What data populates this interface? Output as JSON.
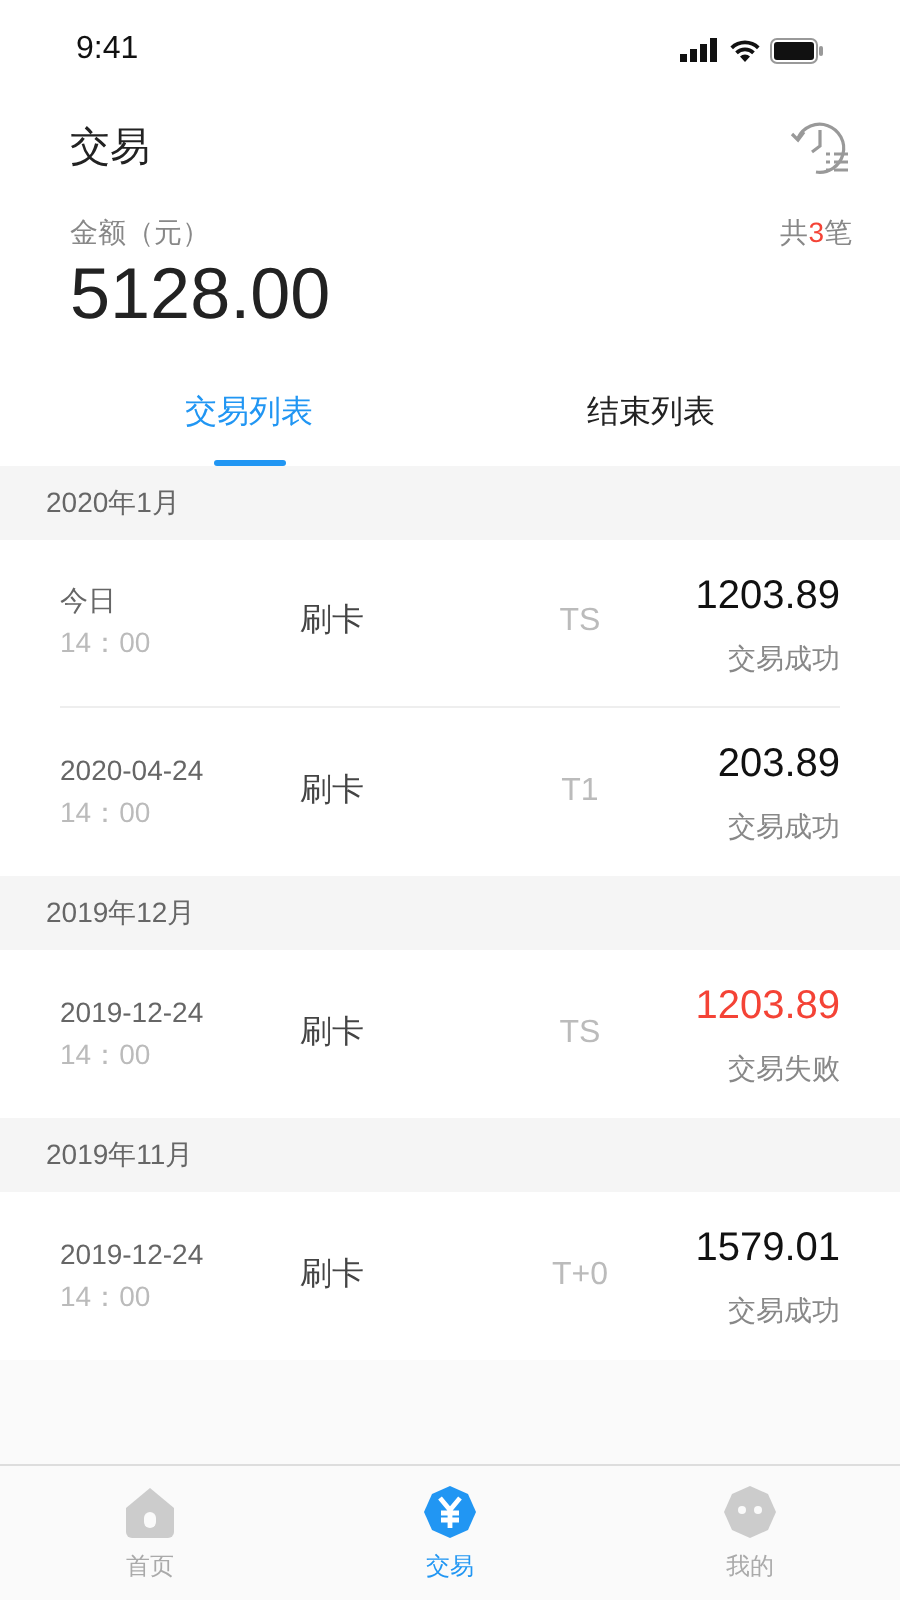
{
  "status_bar": {
    "time": "9:41"
  },
  "header": {
    "title": "交易"
  },
  "summary": {
    "label": "金额（元）",
    "amount": "5128.00",
    "count_prefix": "共",
    "count": "3",
    "count_suffix": "笔"
  },
  "tabs": [
    {
      "label": "交易列表",
      "selected": true
    },
    {
      "label": "结束列表",
      "selected": false
    }
  ],
  "groups": [
    {
      "month": "2020年1月",
      "items": [
        {
          "date": "今日",
          "time": "14：00",
          "type": "刷卡",
          "settle": "TS",
          "amount": "1203.89",
          "status": "交易成功",
          "failed": false
        },
        {
          "date": "2020-04-24",
          "time": "14：00",
          "type": "刷卡",
          "settle": "T1",
          "amount": "203.89",
          "status": "交易成功",
          "failed": false
        }
      ]
    },
    {
      "month": "2019年12月",
      "items": [
        {
          "date": "2019-12-24",
          "time": "14：00",
          "type": "刷卡",
          "settle": "TS",
          "amount": "1203.89",
          "status": "交易失败",
          "failed": true
        }
      ]
    },
    {
      "month": "2019年11月",
      "items": [
        {
          "date": "2019-12-24",
          "time": "14：00",
          "type": "刷卡",
          "settle": "T+0",
          "amount": "1579.01",
          "status": "交易成功",
          "failed": false
        }
      ]
    }
  ],
  "bottom_nav": [
    {
      "label": "首页",
      "kind": "home",
      "selected": false
    },
    {
      "label": "交易",
      "kind": "yuan",
      "selected": true
    },
    {
      "label": "我的",
      "kind": "face",
      "selected": false
    }
  ]
}
